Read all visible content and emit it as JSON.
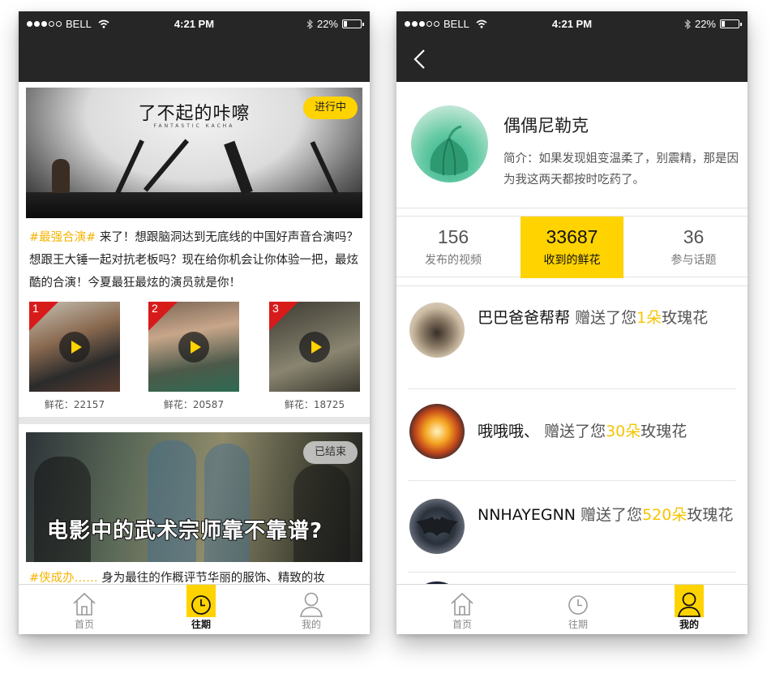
{
  "status_bar": {
    "carrier": "BELL",
    "time": "4:21 PM",
    "battery": "22%",
    "battery_level": 0.22
  },
  "left_screen": {
    "cards": [
      {
        "banner_title": "了不起的咔嚓",
        "banner_subtitle": "FANTASTIC KACHA",
        "badge": "进行中",
        "tag": "#最强合演#",
        "text": "来了！想跟脑洞达到无底线的中国好声音合演吗？想跟王大锤一起对抗老板吗？现在给你机会让你体验一把，最炫酷的合演！今夏最狂最炫的演员就是你！",
        "videos": [
          {
            "rank": "1",
            "flowers": "鲜花：22157"
          },
          {
            "rank": "2",
            "flowers": "鲜花：20587"
          },
          {
            "rank": "3",
            "flowers": "鲜花：18725"
          }
        ]
      },
      {
        "banner_text": "电影中的武术宗师靠不靠谱?",
        "badge": "已结束",
        "tag": "#侠成办……",
        "text": "身为最往的作概评节华丽的服饰、精致的妆"
      }
    ],
    "tabs": [
      {
        "label": "首页",
        "icon": "home-icon"
      },
      {
        "label": "往期",
        "icon": "clock-icon"
      },
      {
        "label": "我的",
        "icon": "user-icon"
      }
    ],
    "active_tab": "往期"
  },
  "right_screen": {
    "profile": {
      "name": "偶偶尼勒克",
      "bio": "简介：如果发现姐变温柔了，别震精，那是因为我这两天都按时吃药了。"
    },
    "stats": [
      {
        "value": "156",
        "label": "发布的视频"
      },
      {
        "value": "33687",
        "label": "收到的鲜花"
      },
      {
        "value": "36",
        "label": "参与话题"
      }
    ],
    "active_stat": "收到的鲜花",
    "gifts": [
      {
        "user": "巴巴爸爸帮帮",
        "pre": "赠送了您",
        "qty": "1朵",
        "post": "玫瑰花"
      },
      {
        "user": "哦哦哦、",
        "pre": "赠送了您",
        "qty": "30朵",
        "post": "玫瑰花"
      },
      {
        "user": "NNHAYEGNN",
        "pre": "赠送了您",
        "qty": "520朵",
        "post": "玫瑰花"
      }
    ],
    "tabs": [
      {
        "label": "首页",
        "icon": "home-icon"
      },
      {
        "label": "往期",
        "icon": "clock-icon"
      },
      {
        "label": "我的",
        "icon": "user-icon"
      }
    ],
    "active_tab": "我的"
  },
  "colors": {
    "accent": "#ffd300",
    "dark_bar": "#262626",
    "rank_red": "#d71b1b",
    "highlight_text": "#f5c400"
  }
}
